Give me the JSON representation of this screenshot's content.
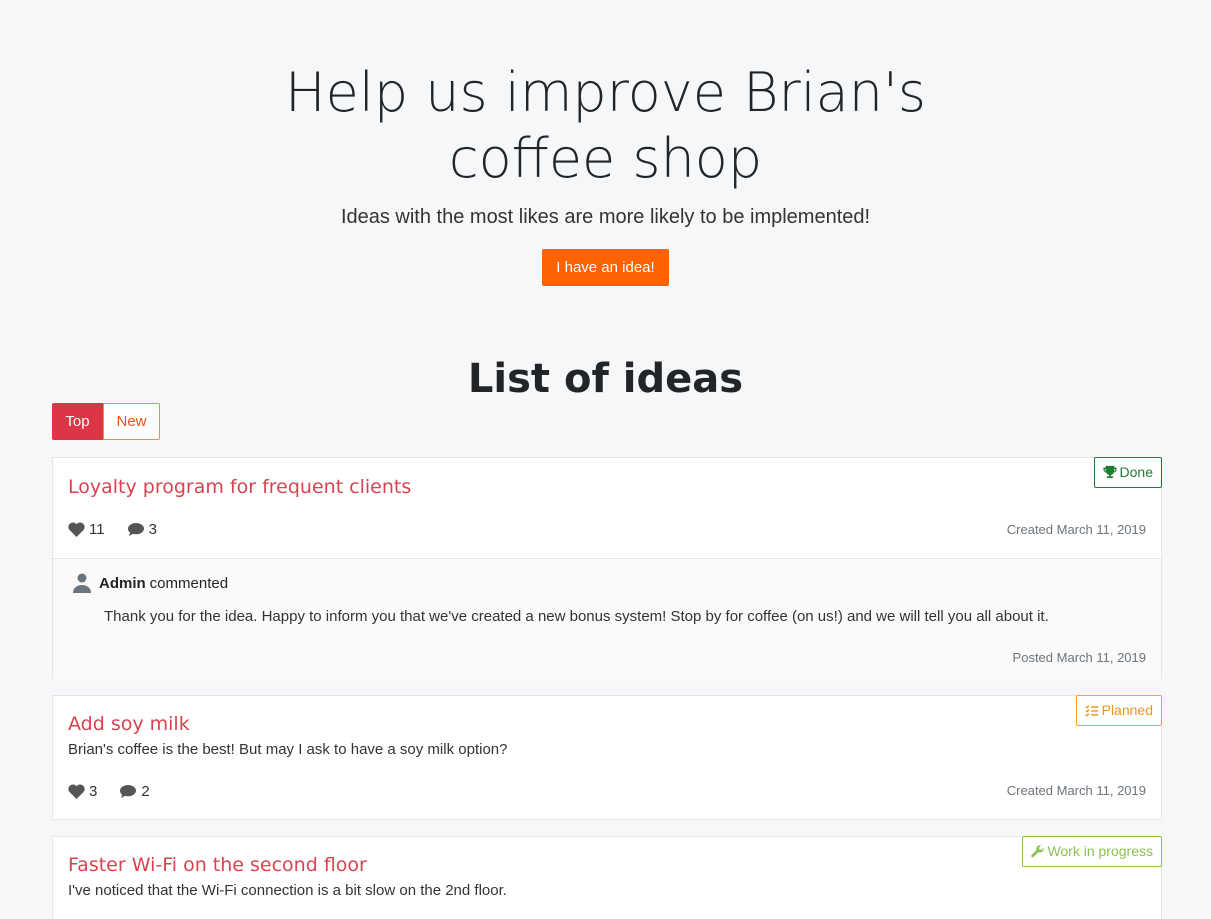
{
  "hero": {
    "title": "Help us improve Brian's coffee shop",
    "subtitle": "Ideas with the most likes are more likely to be implemented!",
    "cta_label": "I have an idea!"
  },
  "list": {
    "title": "List of ideas",
    "tabs": [
      {
        "label": "Top",
        "active": true
      },
      {
        "label": "New",
        "active": false
      }
    ]
  },
  "ideas": [
    {
      "title": "Loyalty program for frequent clients",
      "description": "",
      "status": "Done",
      "status_icon": "trophy-icon",
      "likes": "11",
      "comments": "3",
      "created": "Created March 11, 2019",
      "admin_comment": {
        "author": "Admin",
        "verb": "commented",
        "text": "Thank you for the idea. Happy to inform you that we've created a new bonus system! Stop by for coffee (on us!) and we will tell you all about it.",
        "posted": "Posted March 11, 2019"
      }
    },
    {
      "title": "Add soy milk",
      "description": "Brian's coffee is the best! But may I ask to have a soy milk option?",
      "status": "Planned",
      "status_icon": "checklist-icon",
      "likes": "3",
      "comments": "2",
      "created": "Created March 11, 2019"
    },
    {
      "title": "Faster Wi-Fi on the second floor",
      "description": "I've noticed that the Wi-Fi connection is a bit slow on the 2nd floor.",
      "status": "Work in progress",
      "status_icon": "wrench-icon"
    }
  ],
  "colors": {
    "accent": "#ff6200",
    "title_red": "#d9434f",
    "done": "#1e7e34",
    "planned": "#f0961a",
    "wip": "#8cc152"
  }
}
